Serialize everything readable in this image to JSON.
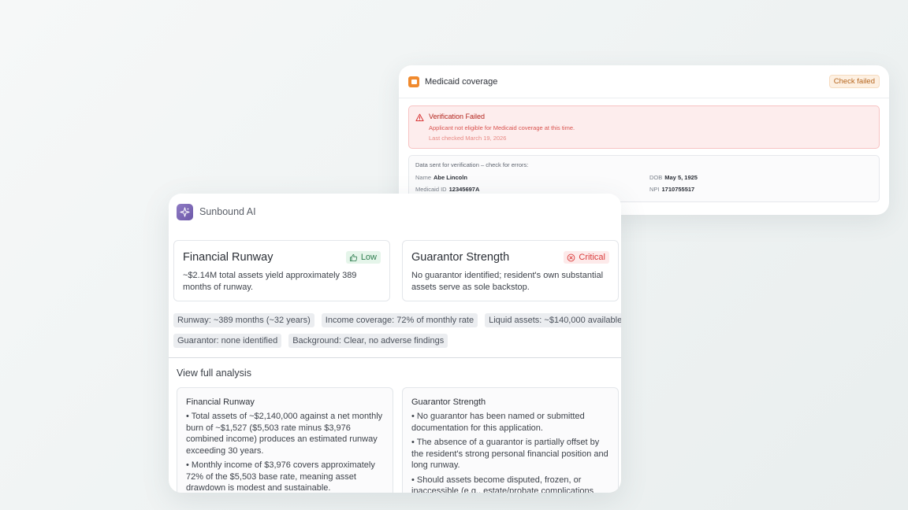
{
  "medicaid": {
    "title": "Medicaid coverage",
    "status_badge": "Check failed",
    "alert": {
      "title": "Verification Failed",
      "message": "Applicant not eligible for Medicaid coverage at this time.",
      "last_checked": "Last checked March 19, 2026"
    },
    "data_panel": {
      "heading": "Data sent for verification – check for errors:",
      "fields": [
        {
          "label": "Name",
          "value": "Abe Lincoln"
        },
        {
          "label": "DOB",
          "value": "May 5, 1925"
        },
        {
          "label": "Medicaid ID",
          "value": "12345697A"
        },
        {
          "label": "NPI",
          "value": "1710755517"
        }
      ]
    }
  },
  "ai": {
    "title": "Sunbound AI",
    "metrics": [
      {
        "name": "Financial Runway",
        "badge": "Low",
        "badge_color": "#2e7d4f",
        "description": "~$2.14M total assets yield approximately 389 months of runway."
      },
      {
        "name": "Guarantor Strength",
        "badge": "Critical",
        "badge_color": "#d93a3a",
        "description": "No guarantor identified; resident's own substantial assets serve as sole backstop."
      }
    ],
    "tags": [
      "Runway: ~389 months (~32 years)",
      "Income coverage: 72% of monthly rate",
      "Liquid assets: ~$140,000 available",
      "Guarantor: none identified",
      "Background: Clear, no adverse findings"
    ],
    "view_full_label": "View full analysis",
    "details": [
      {
        "title": "Financial Runway",
        "items": [
          "• Total assets of ~$2,140,000 against a net monthly burn of ~$1,527 ($5,503 rate minus $3,976 combined income) produces an estimated runway exceeding 30 years.",
          "• Monthly income of $3,976 covers approximately 72% of the $5,503 base rate, meaning asset drawdown is modest and sustainable."
        ]
      },
      {
        "title": "Guarantor Strength",
        "items": [
          "• No guarantor has been named or submitted documentation for this application.",
          "• The absence of a guarantor is partially offset by the resident's strong personal financial position and long runway.",
          "• Should assets become disputed, frozen, or inaccessible (e.g., estate/probate complications"
        ]
      }
    ]
  }
}
